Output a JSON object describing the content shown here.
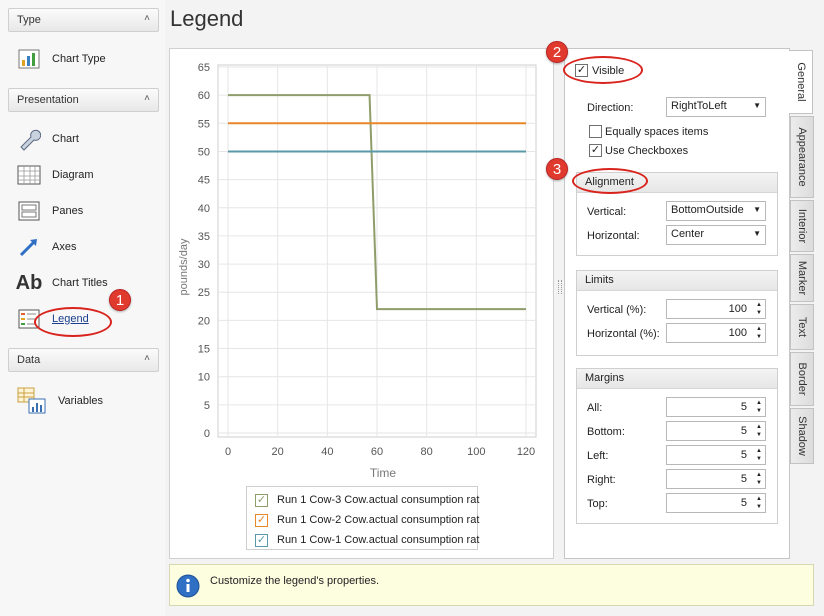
{
  "page_title": "Legend",
  "sidebar": {
    "groups": [
      {
        "label": "Type"
      },
      {
        "label": "Presentation"
      },
      {
        "label": "Data"
      }
    ],
    "items": [
      {
        "label": "Chart Type",
        "icon": "chart-type-icon"
      },
      {
        "label": "Chart",
        "icon": "wrench-icon"
      },
      {
        "label": "Diagram",
        "icon": "diagram-icon"
      },
      {
        "label": "Panes",
        "icon": "panes-icon"
      },
      {
        "label": "Axes",
        "icon": "axes-icon"
      },
      {
        "label": "Chart Titles",
        "icon": "chart-titles-icon",
        "glyph": "Ab"
      },
      {
        "label": "Legend",
        "icon": "legend-icon"
      },
      {
        "label": "Variables",
        "icon": "variables-icon"
      }
    ]
  },
  "chart_data": {
    "type": "line",
    "xlabel": "Time",
    "ylabel": "pounds/day",
    "xlim": [
      0,
      120
    ],
    "ylim": [
      0,
      65
    ],
    "x_ticks": [
      "0",
      "20",
      "40",
      "60",
      "80",
      "100",
      "120"
    ],
    "y_ticks": [
      "0",
      "5",
      "10",
      "15",
      "20",
      "25",
      "30",
      "35",
      "40",
      "45",
      "50",
      "55",
      "60",
      "65"
    ],
    "grid": true,
    "series": [
      {
        "name": "Run 1 Cow-3 Cow.actual consumption rat",
        "color": "#8f9d6a",
        "x": [
          0,
          57,
          60,
          120
        ],
        "y": [
          60,
          60,
          22,
          22
        ]
      },
      {
        "name": "Run 1 Cow-2 Cow.actual consumption rat",
        "color": "#e8862a",
        "x": [
          0,
          120
        ],
        "y": [
          55,
          55
        ]
      },
      {
        "name": "Run 1 Cow-1 Cow.actual consumption rat",
        "color": "#5a9aa8",
        "x": [
          0,
          120
        ],
        "y": [
          50,
          50
        ]
      }
    ],
    "legend_placement": "bottom-center"
  },
  "props": {
    "visible_label": "Visible",
    "visible_checked": "✓",
    "direction_label": "Direction:",
    "direction_value": "RightToLeft",
    "equally_spaces_label": "Equally spaces items",
    "equally_spaces_checked": "",
    "use_checkboxes_label": "Use Checkboxes",
    "use_checkboxes_checked": "✓",
    "alignment": {
      "title": "Alignment",
      "vertical_label": "Vertical:",
      "vertical_value": "BottomOutside",
      "horizontal_label": "Horizontal:",
      "horizontal_value": "Center"
    },
    "limits": {
      "title": "Limits",
      "vertical_label": "Vertical (%):",
      "vertical_value": "100",
      "horizontal_label": "Horizontal (%):",
      "horizontal_value": "100"
    },
    "margins": {
      "title": "Margins",
      "all_label": "All:",
      "all_value": "5",
      "bottom_label": "Bottom:",
      "bottom_value": "5",
      "left_label": "Left:",
      "left_value": "5",
      "right_label": "Right:",
      "right_value": "5",
      "top_label": "Top:",
      "top_value": "5"
    }
  },
  "tabs": [
    "General",
    "Appearance",
    "Interior",
    "Marker",
    "Text",
    "Border",
    "Shadow"
  ],
  "status_message": "Customize the legend's properties.",
  "callouts": [
    "1",
    "2",
    "3"
  ],
  "colors": {
    "accent_red": "#e03a2e",
    "status_bg": "#fdfde0"
  }
}
